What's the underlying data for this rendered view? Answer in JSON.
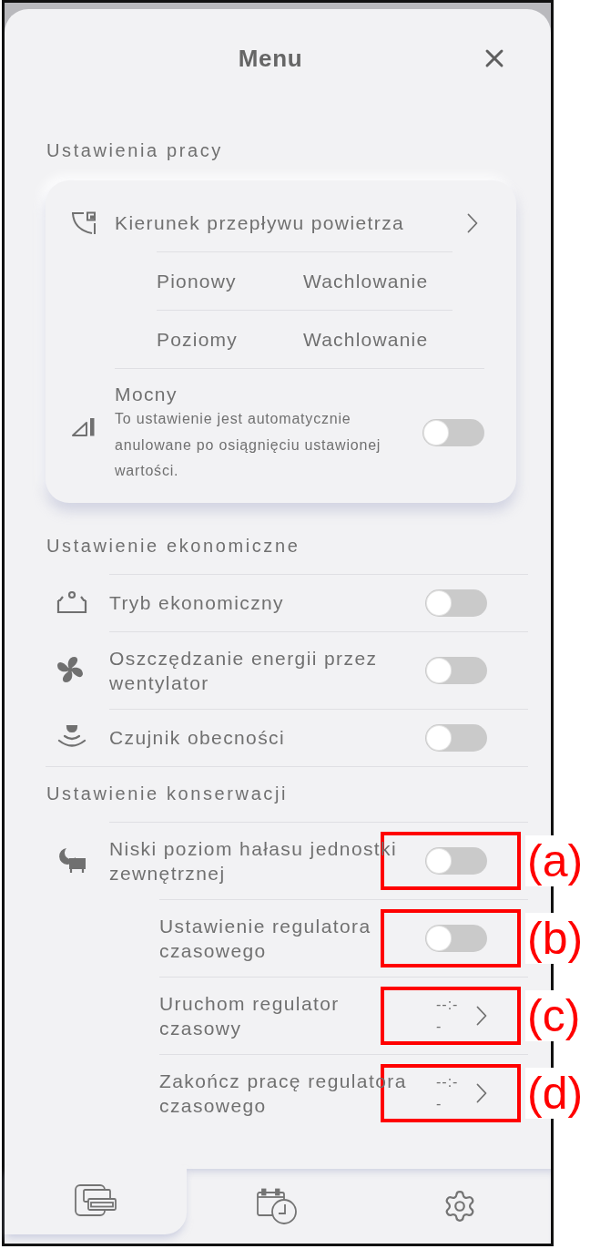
{
  "header": {
    "title": "Menu"
  },
  "sections": [
    {
      "kind": "card",
      "title": "Ustawienia pracy",
      "rows": [
        {
          "kind": "link",
          "label": "Kierunek przepływu powietrza",
          "children": [
            {
              "kind": "value",
              "label": "Pionowy",
              "value": "Wachlowanie"
            },
            {
              "kind": "value",
              "label": "Poziomy",
              "value": "Wachlowanie"
            }
          ]
        },
        {
          "kind": "toggle",
          "label": "Mocny",
          "description": "To ustawienie jest automatycznie anulowane po osiągnięciu ustawionej wartości.",
          "on": false
        }
      ]
    },
    {
      "kind": "list",
      "title": "Ustawienie ekonomiczne",
      "rows": [
        {
          "kind": "toggle",
          "label": "Tryb ekonomiczny",
          "on": false
        },
        {
          "kind": "toggle",
          "label": "Oszczędzanie energii przez wentylator",
          "on": false
        },
        {
          "kind": "toggle",
          "label": "Czujnik obecności",
          "on": false
        }
      ]
    },
    {
      "kind": "list",
      "title": "Ustawienie konserwacji",
      "rows": [
        {
          "kind": "toggle",
          "label": "Niski poziom hałasu jednostki zewnętrznej",
          "on": false,
          "callout": "(a)",
          "children": [
            {
              "kind": "toggle",
              "label": "Ustawienie regulatora czasowego",
              "on": false,
              "callout": "(b)"
            },
            {
              "kind": "time",
              "label": "Uruchom regulator czasowy",
              "value": "--:--",
              "callout": "(c)"
            },
            {
              "kind": "time",
              "label": "Zakończ pracę regulatora czasowego",
              "value": "--:--",
              "callout": "(d)"
            }
          ]
        }
      ]
    }
  ],
  "nav": {
    "tabs": [
      {
        "selected": true
      },
      {
        "selected": false
      },
      {
        "selected": false
      }
    ]
  }
}
